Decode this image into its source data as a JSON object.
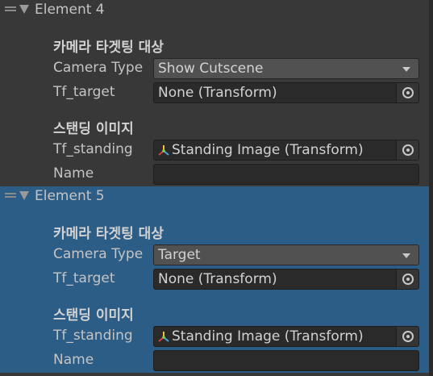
{
  "elements": [
    {
      "title": "Element 4",
      "camera_section": "카메라 타겟팅 대상",
      "camera_type_label": "Camera Type",
      "camera_type_value": "Show Cutscene",
      "tf_target_label": "Tf_target",
      "tf_target_value": "None (Transform)",
      "standing_section": "스탠딩 이미지",
      "tf_standing_label": "Tf_standing",
      "tf_standing_value": "Standing Image (Transform)",
      "name_label": "Name",
      "name_value": ""
    },
    {
      "title": "Element 5",
      "camera_section": "카메라 타겟팅 대상",
      "camera_type_label": "Camera Type",
      "camera_type_value": "Target",
      "tf_target_label": "Tf_target",
      "tf_target_value": "None (Transform)",
      "standing_section": "스탠딩 이미지",
      "tf_standing_label": "Tf_standing",
      "tf_standing_value": "Standing Image (Transform)",
      "name_label": "Name",
      "name_value": ""
    }
  ],
  "colors": {
    "background": "#383838",
    "selected_background": "#2c5d87",
    "field_background": "#2a2a2a",
    "dropdown_background": "#515151",
    "text": "#c4c4c4"
  },
  "icons": [
    "drag-handle-icon",
    "foldout-arrow-icon",
    "dropdown-arrow-icon",
    "object-picker-icon",
    "transform-icon"
  ]
}
